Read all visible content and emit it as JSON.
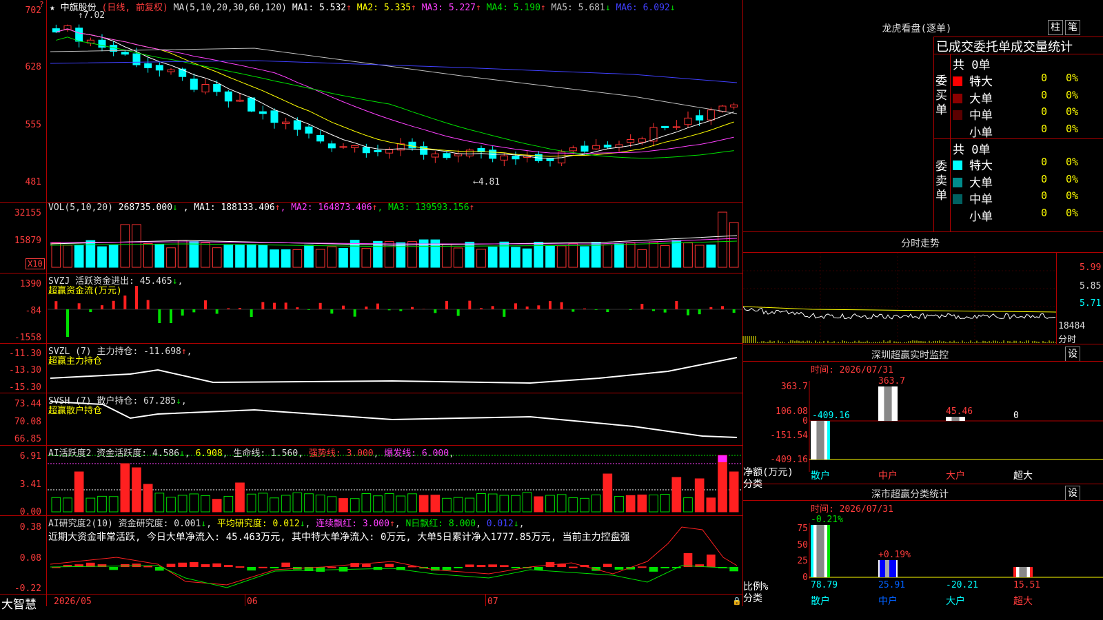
{
  "stock": {
    "star": "★",
    "name": "中旗股份",
    "period": "(日线, 前复权)"
  },
  "ma_header": {
    "prefix": "MA(5,10,20,30,60,120)",
    "items": [
      {
        "label": "MA1: 5.532",
        "arrow": "↑",
        "color": "#ffffff"
      },
      {
        "label": "MA2: 5.335",
        "arrow": "↑",
        "color": "#ffff00"
      },
      {
        "label": "MA3: 5.227",
        "arrow": "↑",
        "color": "#ff40ff"
      },
      {
        "label": "MA4: 5.190",
        "arrow": "↑",
        "color": "#00e000"
      },
      {
        "label": "MA5: 5.681",
        "arrow": "↓",
        "color": "#c0c0c0"
      },
      {
        "label": "MA6: 6.092",
        "arrow": "↓",
        "color": "#4040ff"
      }
    ]
  },
  "price_axis": [
    "702",
    "628",
    "555",
    "481"
  ],
  "price_marks": {
    "high": "7.02",
    "low": "4.81",
    "high_arrow": "↑",
    "low_arrow": "←"
  },
  "vol": {
    "header": "VOL(5,10,20)",
    "value": "268735.000",
    "arrow": "↓",
    "items": [
      {
        "label": "MA1: 188133.406",
        "arrow": "↑",
        "color": "#ffffff"
      },
      {
        "label": "MA2: 164873.406",
        "arrow": "↑",
        "color": "#ff40ff"
      },
      {
        "label": "MA3: 139593.156",
        "arrow": "↑",
        "color": "#00e000"
      }
    ],
    "axis": [
      "32155",
      "15879"
    ],
    "unit": "X10"
  },
  "svzj": {
    "header": "SVZJ  活跃资金进出: 45.465",
    "arrow": "↓",
    "sub": "超赢资金流(万元)",
    "axis": [
      "1390",
      "-84",
      "-1558"
    ]
  },
  "svzl": {
    "header": "SVZL (7) 主力持仓: -11.698",
    "arrow": "↑",
    "sub": "超赢主力持仓",
    "axis": [
      "-11.30",
      "-13.30",
      "-15.30"
    ]
  },
  "svsh": {
    "header": "SVSH (7) 散户持仓: 67.285",
    "arrow": "↓",
    "sub": "超赢散户持仓",
    "axis": [
      "73.44",
      "70.08",
      "66.85"
    ]
  },
  "ai_active": {
    "header": "AI活跃度2 资金活跃度: 4.586",
    "a1": "↓",
    "v2": "6.908",
    "life": "生命线: 1.560",
    "strong": "强势线: 3.000",
    "burst": "爆发线: 6.000",
    "axis": [
      "6.91",
      "3.41",
      "0.00"
    ]
  },
  "ai_research": {
    "header": "AI研究度2(10) 资金研究度: 0.001",
    "a1": "↓",
    "avg": "平均研究度: 0.012",
    "a2": "↓",
    "streak": "连续飘红: 3.000",
    "a3": "↑",
    "nday": "N日飘红: 8.000",
    "tail": "0.012",
    "a4": "↓",
    "summary": "近期大资金非常活跃, 今日大单净流入: 45.463万元, 其中特大单净流入: 0万元, 大单5日累计净入1777.85万元, 当前主力控盘强",
    "axis": [
      "0.38",
      "0.08",
      "-0.22"
    ]
  },
  "dates": [
    "2026/05",
    "06",
    "07"
  ],
  "brand": "大智慧",
  "right": {
    "lhb_title": "龙虎看盘(逐单)",
    "btn_zhu": "柱",
    "btn_gong": "笔",
    "stat_title": "已成交委托单成交量统计",
    "buy": {
      "label": "委买单",
      "total": "共 0单",
      "rows": [
        {
          "name": "特大",
          "count": "0",
          "pct": "0%",
          "color": "#ff0000"
        },
        {
          "name": "大单",
          "count": "0",
          "pct": "0%",
          "color": "#8b0000"
        },
        {
          "name": "中单",
          "count": "0",
          "pct": "0%",
          "color": "#5a0000"
        },
        {
          "name": "小单",
          "count": "0",
          "pct": "0%",
          "color": ""
        }
      ]
    },
    "sell": {
      "label": "委卖单",
      "total": "共 0单",
      "rows": [
        {
          "name": "特大",
          "count": "0",
          "pct": "0%",
          "color": "#00ffff"
        },
        {
          "name": "大单",
          "count": "0",
          "pct": "0%",
          "color": "#008b8b"
        },
        {
          "name": "中单",
          "count": "0",
          "pct": "0%",
          "color": "#006060"
        },
        {
          "name": "小单",
          "count": "0",
          "pct": "0%",
          "color": ""
        }
      ]
    },
    "intraday_title": "分时走势",
    "intraday_axis": [
      "5.99",
      "5.85",
      "5.71",
      "18484"
    ],
    "intraday_unit": "分时",
    "sz_monitor": {
      "title": "深圳超赢实时监控",
      "settings": "设",
      "time": "时间: 2026/07/31",
      "axis": [
        "363.7",
        "106.08",
        "0",
        "-151.54",
        "-409.16"
      ],
      "values": {
        "retail": "-409.16",
        "mid": "363.7",
        "large": "45.46",
        "super": "0"
      },
      "side_label1": "净额(万元)",
      "side_label2": "分类",
      "cats": [
        "散户",
        "中户",
        "大户",
        "超大"
      ]
    },
    "sz_classify": {
      "title": "深市超赢分类统计",
      "settings": "设",
      "time": "时间: 2026/07/31",
      "axis": [
        "75",
        "50",
        "25",
        "0"
      ],
      "top_labels": {
        "retail": "-0.21%",
        "mid": "+0.19%"
      },
      "values": {
        "retail": "78.79",
        "mid": "25.91",
        "large": "-20.21",
        "super": "15.51"
      },
      "side_label1": "比例%",
      "side_label2": "分类",
      "cats": [
        "散户",
        "中户",
        "大户",
        "超大"
      ]
    }
  }
}
